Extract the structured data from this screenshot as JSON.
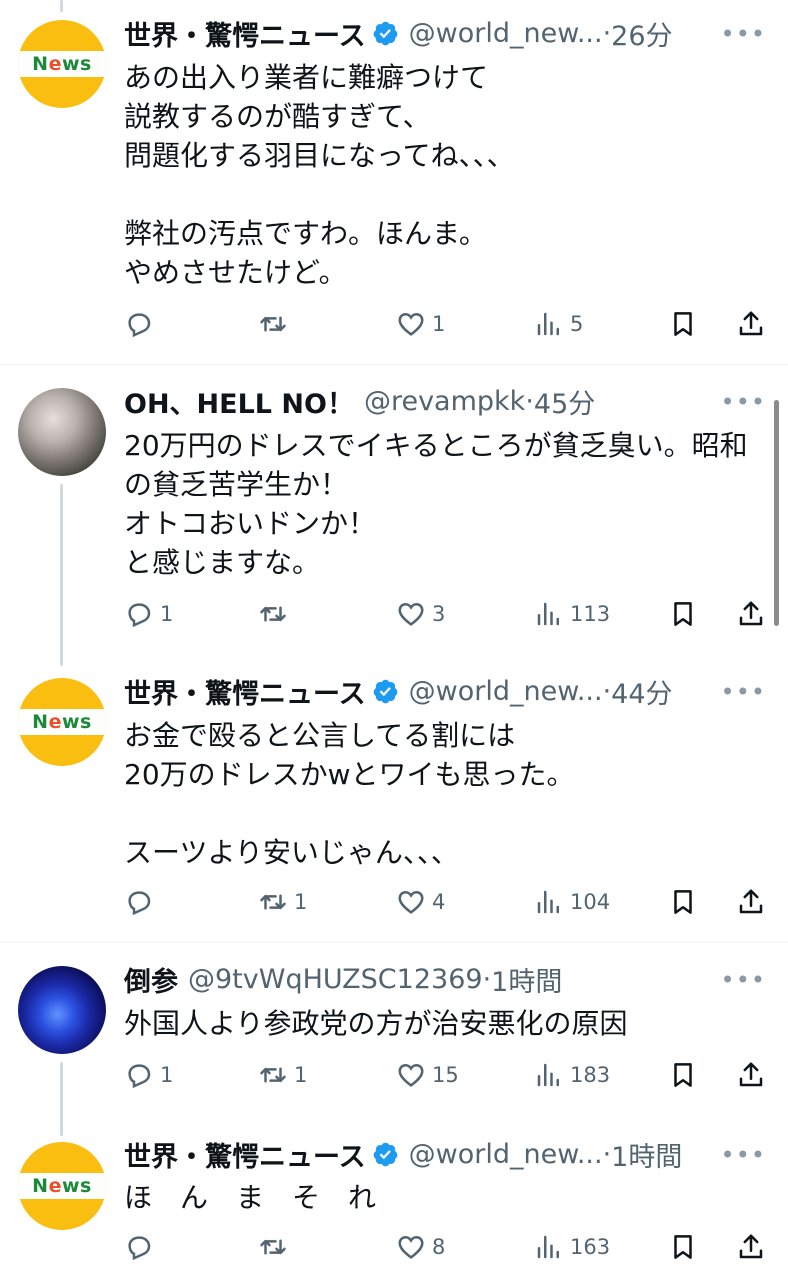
{
  "tweets": [
    {
      "name": "世界・驚愕ニュース",
      "handle": "@world_new...",
      "sep": "·",
      "time": "26分",
      "avatar_text": "News",
      "text": "あの出入り業者に難癖つけて\n説教するのが酷すぎて、\n問題化する羽目になってね、、、\n\n弊社の汚点ですわ。ほんま。\nやめさせたけど。",
      "reply_count": "",
      "retweet_count": "",
      "like_count": "1",
      "view_count": "5",
      "more": "•••"
    },
    {
      "name": "OH、HELL NO！",
      "handle": "@revampkk",
      "sep": "·",
      "time": "45分",
      "text": "20万円のドレスでイキるところが貧乏臭い。昭和の貧乏苦学生か！\nオトコおいドンか！\nと感じますな。",
      "reply_count": "1",
      "retweet_count": "",
      "like_count": "3",
      "view_count": "113",
      "more": "•••"
    },
    {
      "name": "世界・驚愕ニュース",
      "handle": "@world_new...",
      "sep": "·",
      "time": "44分",
      "avatar_text": "News",
      "text": "お金で殴ると公言してる割には\n20万のドレスかwとワイも思った。\n\nスーツより安いじゃん、、、",
      "reply_count": "",
      "retweet_count": "1",
      "like_count": "4",
      "view_count": "104",
      "more": "•••"
    },
    {
      "name": "倒参",
      "handle": "@9tvWqHUZSC12369",
      "sep": "·",
      "time": "1時間",
      "text": "外国人より参政党の方が治安悪化の原因",
      "reply_count": "1",
      "retweet_count": "1",
      "like_count": "15",
      "view_count": "183",
      "more": "•••"
    },
    {
      "name": "世界・驚愕ニュース",
      "handle": "@world_new...",
      "sep": "·",
      "time": "1時間",
      "avatar_text": "News",
      "text": "ほ　ん　ま　そ　れ",
      "reply_count": "",
      "retweet_count": "",
      "like_count": "8",
      "view_count": "163",
      "more": "•••"
    }
  ],
  "colors": {
    "text": "#0f1419",
    "secondary": "#536471",
    "verified": "#1d9bf0",
    "news_avatar_bg": "#f9be10",
    "divider": "#eff3f4"
  }
}
